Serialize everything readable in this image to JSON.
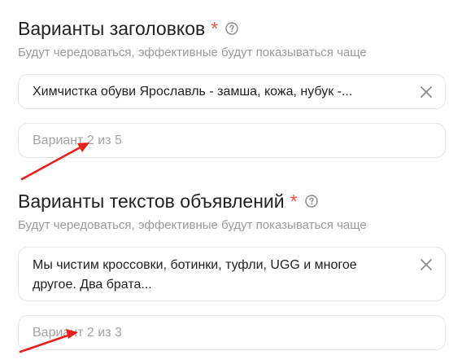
{
  "headlines": {
    "title": "Варианты заголовков",
    "required_mark": "*",
    "subtitle": "Будут чередоваться, эффективные будут показываться чаще",
    "field_value": "Химчистка обуви Ярославль - замша, кожа, нубук -...",
    "next_placeholder": "Вариант 2 из 5"
  },
  "ad_texts": {
    "title": "Варианты текстов объявлений",
    "required_mark": "*",
    "subtitle": "Будут чередоваться, эффективные будут показываться чаще",
    "field_value": "Мы чистим кроссовки, ботинки, туфли, UGG и многое другое. Два брата...",
    "next_placeholder": "Вариант 2 из 3"
  },
  "icons": {
    "help": "help-circle-icon",
    "clear": "close-icon",
    "annotation": "red-arrow-icon"
  },
  "colors": {
    "required": "#f0524e",
    "annotation_arrow": "#e8201c",
    "muted_text": "#9a9a9a",
    "field_border": "#e6e6e6"
  }
}
